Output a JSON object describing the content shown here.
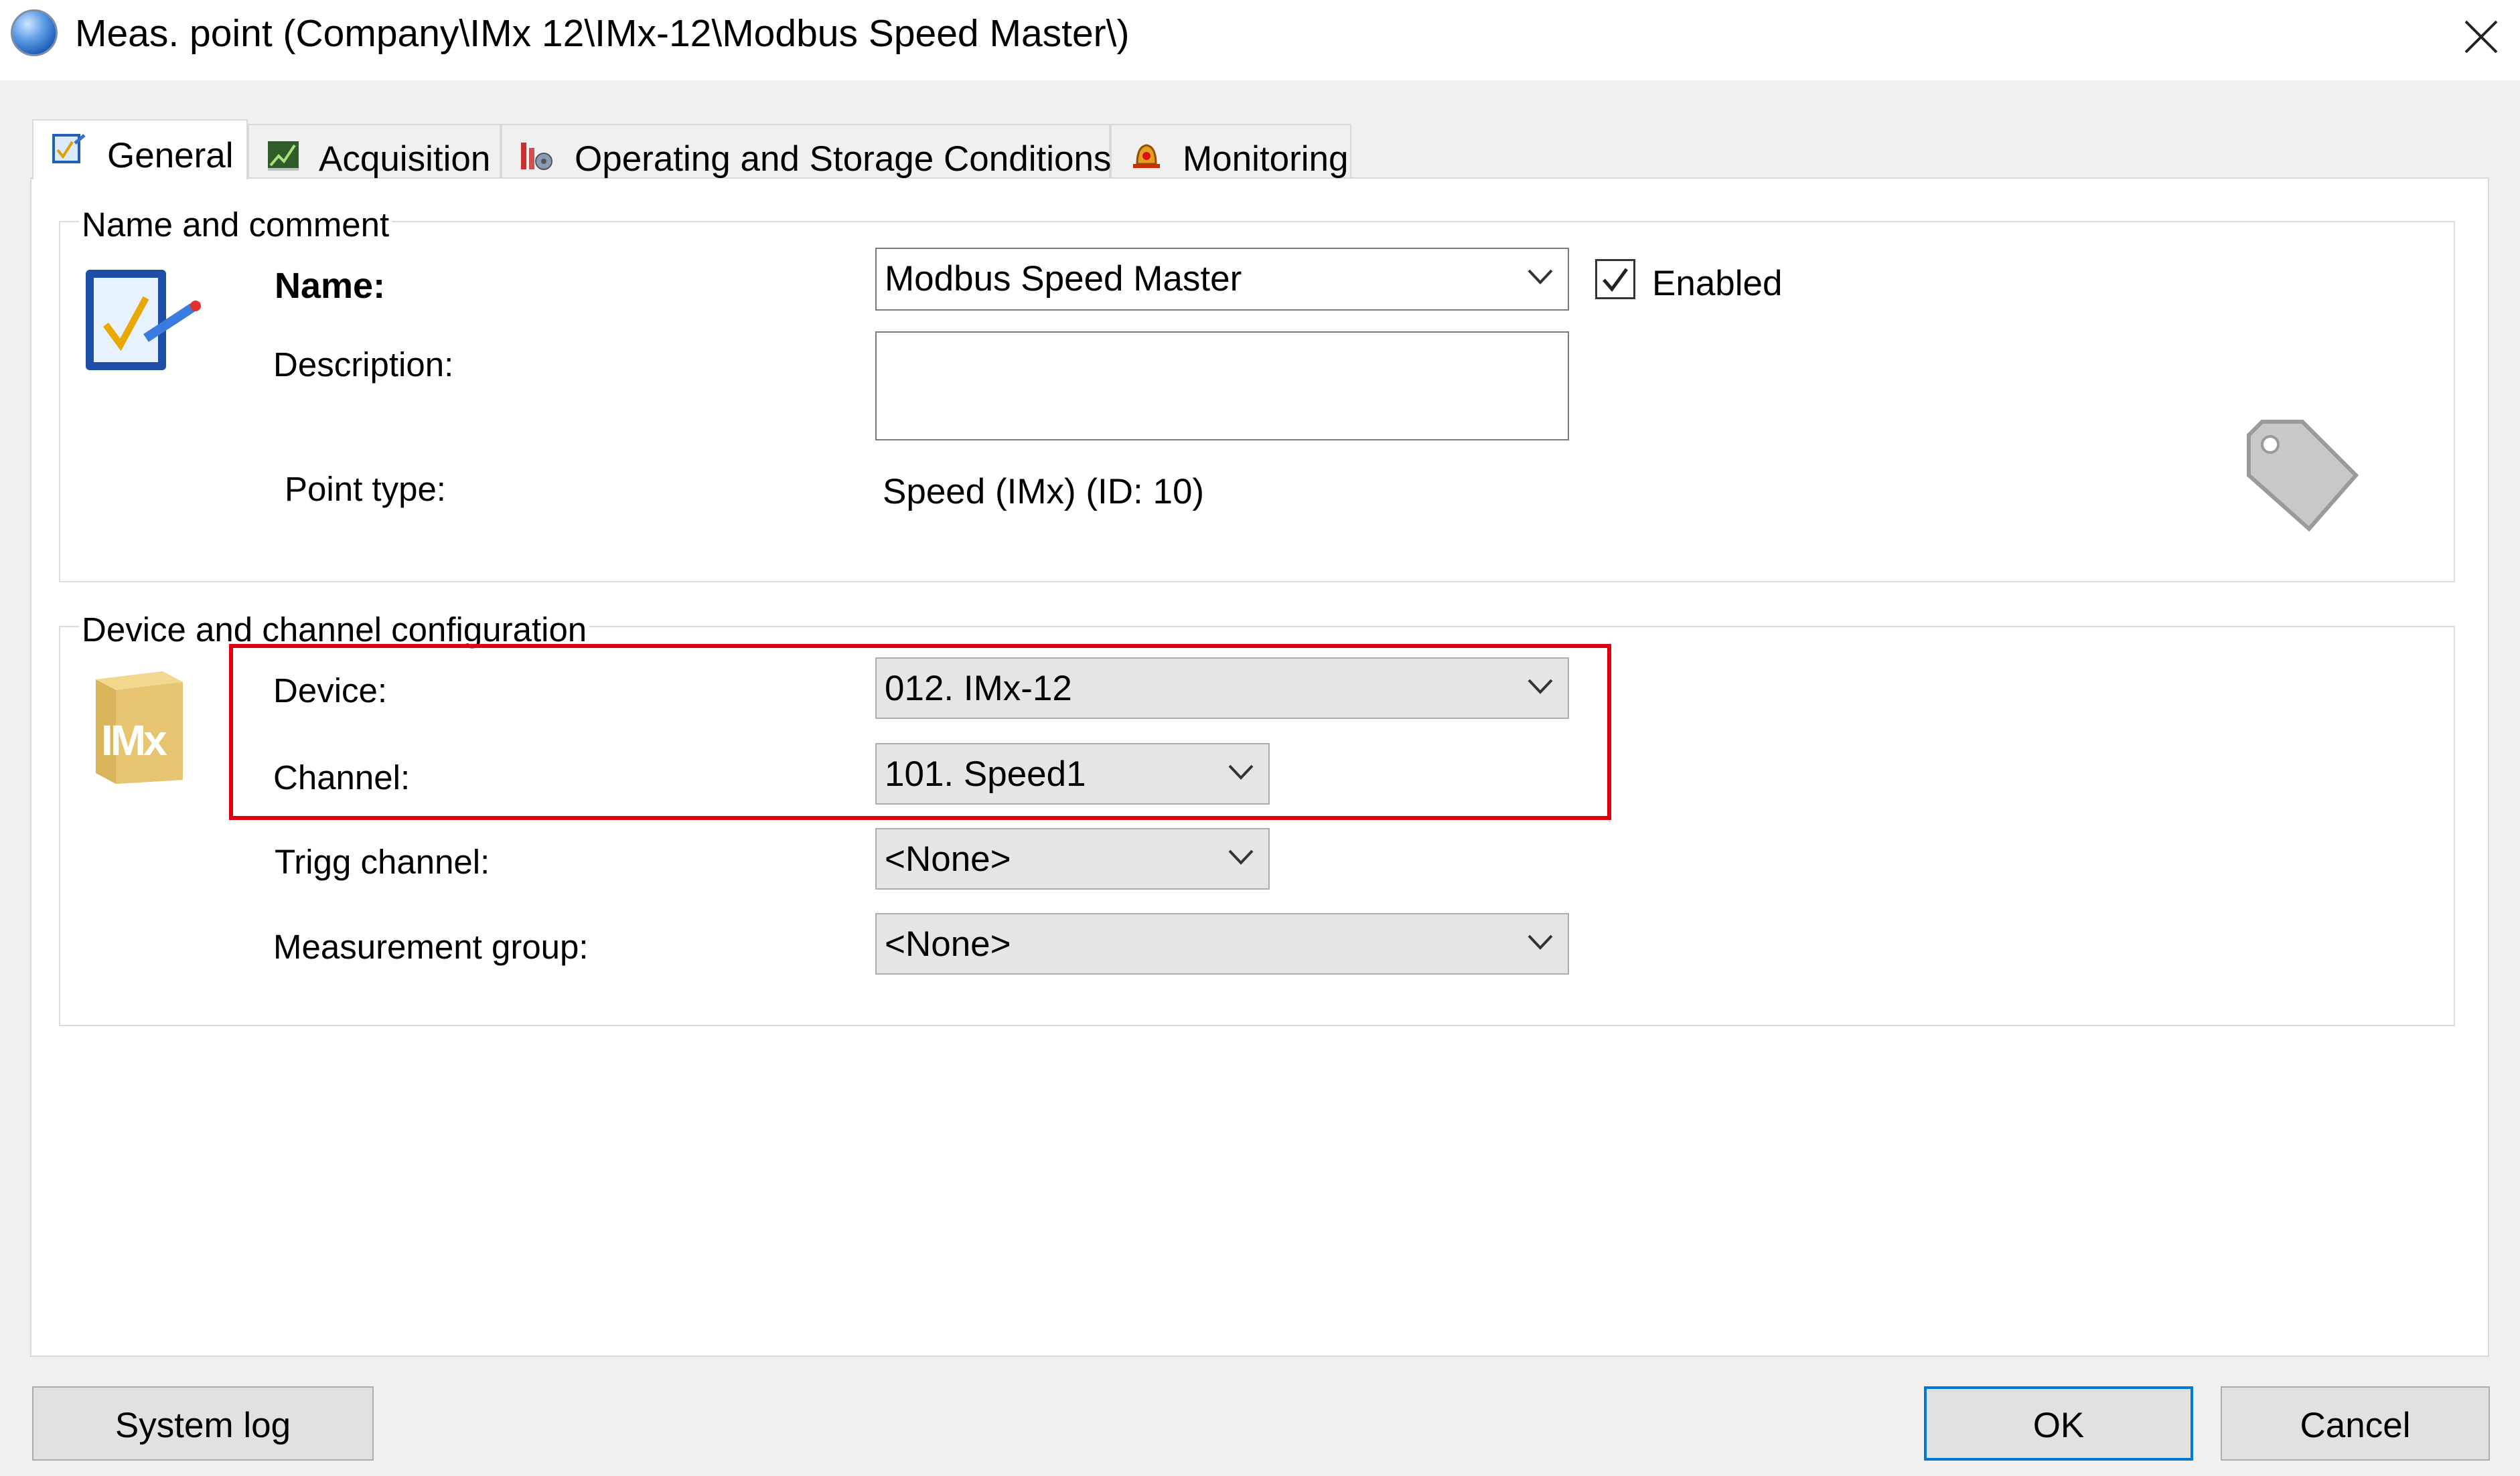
{
  "window": {
    "title": "Meas. point (Company\\IMx 12\\IMx-12\\Modbus Speed Master\\)",
    "icons": {
      "app": "app-globe-icon",
      "close": "close-icon"
    }
  },
  "tabs": [
    {
      "label": "General",
      "icon": "general-tab-icon",
      "active": true
    },
    {
      "label": "Acquisition",
      "icon": "acquisition-chart-icon",
      "active": false
    },
    {
      "label": "Operating and Storage Conditions",
      "icon": "conditions-icon",
      "active": false
    },
    {
      "label": "Monitoring",
      "icon": "alarm-bell-icon",
      "active": false
    }
  ],
  "name_group": {
    "title": "Name and comment",
    "name_label": "Name:",
    "name_value": "Modbus Speed Master",
    "enabled_label": "Enabled",
    "enabled_checked": true,
    "description_label": "Description:",
    "description_value": "",
    "point_type_label": "Point type:",
    "point_type_value": "Speed (IMx) (ID: 10)",
    "icons": {
      "edit": "edit-checklist-icon",
      "tag": "tag-icon"
    }
  },
  "device_group": {
    "title": "Device and channel configuration",
    "device_label": "Device:",
    "device_value": "012. IMx-12",
    "channel_label": "Channel:",
    "channel_value": "101. Speed1",
    "trigg_label": "Trigg channel:",
    "trigg_value": "<None>",
    "meas_group_label": "Measurement group:",
    "meas_group_value": "<None>",
    "device_icon_text": "IMx",
    "icons": {
      "device": "imx-device-icon"
    }
  },
  "annotation": {
    "highlight_color": "#e0000f"
  },
  "buttons": {
    "system_log": "System log",
    "ok": "OK",
    "cancel": "Cancel"
  },
  "colors": {
    "accent": "#0078d7",
    "highlight": "#e0000f"
  }
}
